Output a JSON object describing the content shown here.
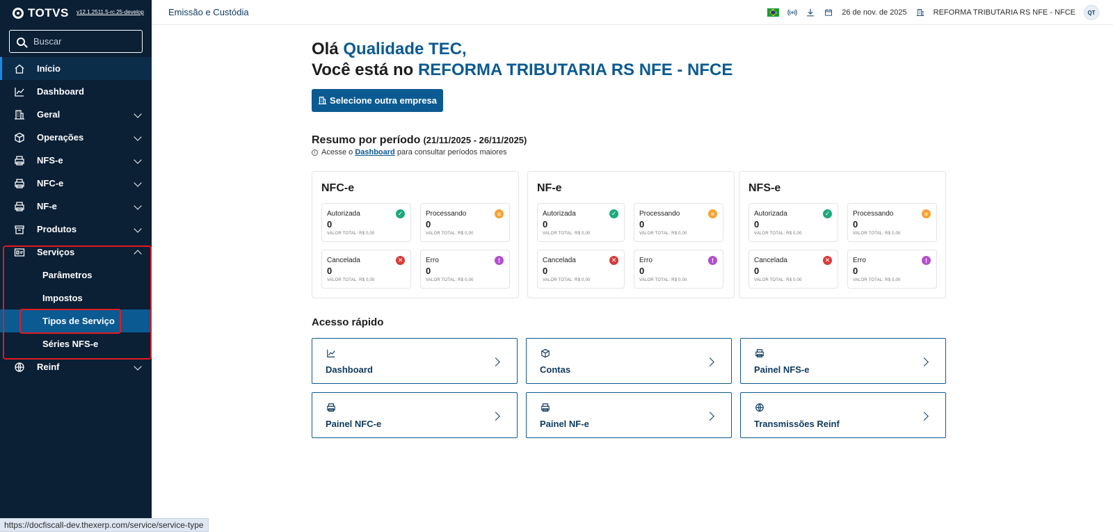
{
  "sidebar": {
    "brand": "TOTVS",
    "version": "v12.1.2511.5-rc.25-develop",
    "search_placeholder": "Buscar",
    "items": [
      {
        "label": "Início"
      },
      {
        "label": "Dashboard"
      },
      {
        "label": "Geral"
      },
      {
        "label": "Operações"
      },
      {
        "label": "NFS-e"
      },
      {
        "label": "NFC-e"
      },
      {
        "label": "NF-e"
      },
      {
        "label": "Produtos"
      },
      {
        "label": "Serviços"
      },
      {
        "label": "Reinf"
      }
    ],
    "servicos_sub": [
      {
        "label": "Parâmetros"
      },
      {
        "label": "Impostos"
      },
      {
        "label": "Tipos de Serviço"
      },
      {
        "label": "Séries NFS-e"
      }
    ]
  },
  "statusbar": "https://docfiscall-dev.thexerp.com/service/service-type",
  "topbar": {
    "crumb": "Emissão e Custódia",
    "date": "26 de nov. de 2025",
    "company": "REFORMA TRIBUTARIA RS NFE - NFCE",
    "avatar": "QT"
  },
  "greeting": {
    "hello": "Olá ",
    "user": "Qualidade TEC,",
    "line2": "Você está no ",
    "company": "REFORMA TRIBUTARIA RS NFE - NFCE"
  },
  "select_company_btn": "Selecione outra empresa",
  "resumo": {
    "title": "Resumo por período",
    "period": "(21/11/2025 - 26/11/2025)",
    "hint_pre": "Acesse o ",
    "hint_link": "Dashboard",
    "hint_post": " para consultar períodos maiores"
  },
  "cards": [
    {
      "title": "NFC-e",
      "stats": [
        {
          "label": "Autorizada",
          "value": "0",
          "total": "VALOR TOTAL: R$ 0,00"
        },
        {
          "label": "Processando",
          "value": "0",
          "total": "VALOR TOTAL: R$ 0,00"
        },
        {
          "label": "Cancelada",
          "value": "0",
          "total": "VALOR TOTAL: R$ 0,00"
        },
        {
          "label": "Erro",
          "value": "0",
          "total": "VALOR TOTAL: R$ 0,00"
        }
      ]
    },
    {
      "title": "NF-e",
      "stats": [
        {
          "label": "Autorizada",
          "value": "0",
          "total": "VALOR TOTAL: R$ 0,00"
        },
        {
          "label": "Processando",
          "value": "0",
          "total": "VALOR TOTAL: R$ 0,00"
        },
        {
          "label": "Cancelada",
          "value": "0",
          "total": "VALOR TOTAL: R$ 0,00"
        },
        {
          "label": "Erro",
          "value": "0",
          "total": "VALOR TOTAL: R$ 0,00"
        }
      ]
    },
    {
      "title": "NFS-e",
      "stats": [
        {
          "label": "Autorizada",
          "value": "0",
          "total": "VALOR TOTAL: R$ 0,00"
        },
        {
          "label": "Processando",
          "value": "0",
          "total": "VALOR TOTAL: R$ 0,00"
        },
        {
          "label": "Cancelada",
          "value": "0",
          "total": "VALOR TOTAL: R$ 0,00"
        },
        {
          "label": "Erro",
          "value": "0",
          "total": "VALOR TOTAL: R$ 0,00"
        }
      ]
    }
  ],
  "acesso": {
    "title": "Acesso rápido",
    "items": [
      {
        "label": "Dashboard",
        "icon": "chart-line-icon"
      },
      {
        "label": "Contas",
        "icon": "box-icon"
      },
      {
        "label": "Painel NFS-e",
        "icon": "printer-icon"
      },
      {
        "label": "Painel NFC-e",
        "icon": "printer-icon"
      },
      {
        "label": "Painel NF-e",
        "icon": "printer-icon"
      },
      {
        "label": "Transmissões Reinf",
        "icon": "globe-icon"
      }
    ]
  },
  "colors": {
    "sidebar_bg": "#0b1f35",
    "accent": "#0b5a91",
    "highlight_box": "#e11b22"
  }
}
